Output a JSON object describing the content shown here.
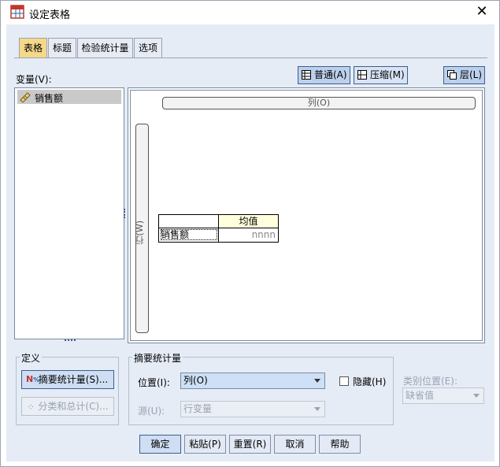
{
  "window": {
    "title": "设定表格",
    "close_label": "✕"
  },
  "tabs": [
    "表格",
    "标题",
    "检验统计量",
    "选项"
  ],
  "variables_label": "变量(V):",
  "toolbar": {
    "normal": "普通(A)",
    "compact": "压缩(M)",
    "layers": "层(L)"
  },
  "variable_list": [
    "销售额"
  ],
  "canvas": {
    "columns_label": "列(O)",
    "rows_label": "行(W)"
  },
  "preview_table": {
    "header": "均值",
    "row_label": "销售额",
    "cell": "nnnn"
  },
  "define_group": {
    "title": "定义",
    "summary_button": "摘要统计量(S)...",
    "categories_button": "分类和总计(C)..."
  },
  "summary_group": {
    "title": "摘要统计量",
    "position_label": "位置(I):",
    "position_value": "列(O)",
    "source_label": "源(U):",
    "source_value": "行变量",
    "hide_label": "隐藏(H)",
    "hide_checked": false
  },
  "category_position": {
    "label": "类别位置(E):",
    "value": "缺省值"
  },
  "bottom_buttons": {
    "ok": "确定",
    "paste": "粘贴(P)",
    "reset": "重置(R)",
    "cancel": "取消",
    "help": "帮助"
  },
  "colors": {
    "accent": "#f5d98a",
    "background": "#e6ecf6"
  }
}
